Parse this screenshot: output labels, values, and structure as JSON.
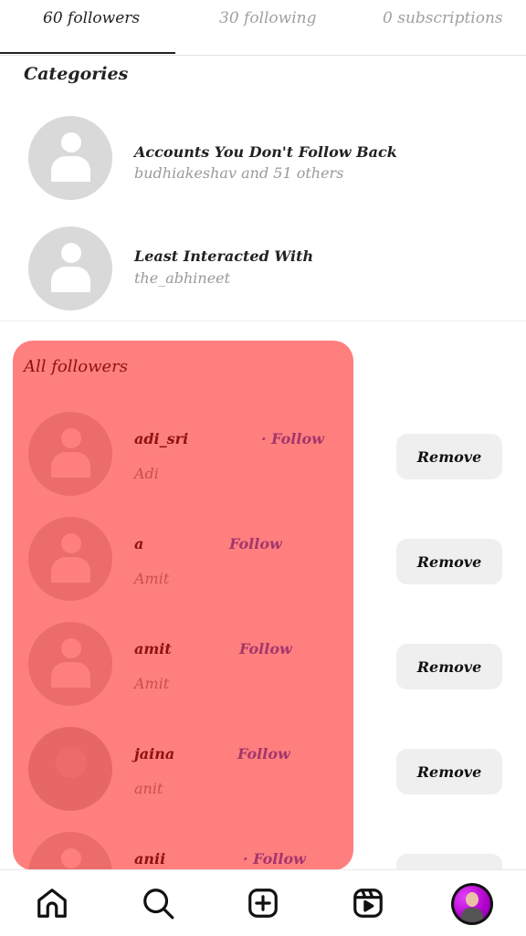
{
  "tabs": [
    {
      "label": "60 followers",
      "active": true
    },
    {
      "label": "30 following",
      "active": false
    },
    {
      "label": "0 subscriptions",
      "active": false
    }
  ],
  "categories": {
    "title": "Categories",
    "items": [
      {
        "title": "Accounts You Don't Follow Back",
        "subtitle": "budhiakeshav and 51 others"
      },
      {
        "title": "Least Interacted With",
        "subtitle": "the_abhineet"
      }
    ]
  },
  "followers": {
    "title": "All followers",
    "follow_label": "Follow",
    "remove_label": "Remove",
    "items": [
      {
        "username": "adi_sri",
        "name": "Adi",
        "follow": "· Follow"
      },
      {
        "username": "a",
        "name": "Amit",
        "follow": "Follow"
      },
      {
        "username": "amit",
        "name": "Amit",
        "follow": "Follow"
      },
      {
        "username": "jaina",
        "name": "anit",
        "follow": "Follow"
      },
      {
        "username": "anii",
        "name": "",
        "follow": "· Follow"
      }
    ]
  },
  "bottom_nav": {
    "items": [
      "home-icon",
      "search-icon",
      "create-icon",
      "reels-icon",
      "profile-avatar"
    ]
  },
  "colors": {
    "overlay": "#ff0000",
    "follow_link": "#4a6cd6",
    "remove_button_bg": "#efefef"
  }
}
